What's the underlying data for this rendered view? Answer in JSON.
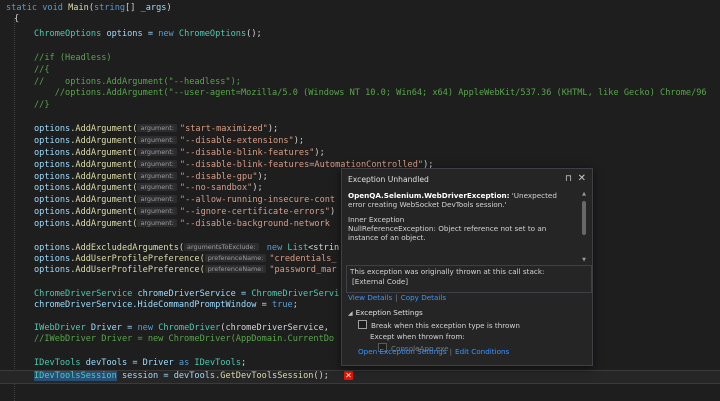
{
  "code": {
    "l1": {
      "kw": "static void",
      "fn": "Main",
      "p1": "(",
      "ty": "string",
      "p2": "[] ",
      "arg": "_args",
      "p3": ")"
    },
    "l2": "{",
    "l3": {
      "ty1": "ChromeOptions",
      "var": " options = ",
      "kw": "new",
      "ty2": " ChromeOptions",
      "rest": "();"
    },
    "l4": "//if (Headless)",
    "l5": "//{",
    "l6": "//    options.AddArgument(\"--headless\");",
    "l7": "    //options.AddArgument(\"--user-agent=Mozilla/5.0 (Windows NT 10.0; Win64; x64) AppleWebKit/537.36 (KHTML, like Gecko) Chrome/96",
    "l8": "//}",
    "args": [
      "\"start-maximized\"",
      "\"--disable-extensions\"",
      "\"--disable-blink-features\"",
      "\"--disable-blink-features=AutomationControlled\"",
      "\"--disable-gpu\"",
      "\"--no-sandbox\"",
      "\"--allow-running-insecure-cont",
      "\"--ignore-certificate-errors\"",
      "\"--disable-background-network"
    ],
    "args_tail": [
      ");",
      ");",
      ");",
      ");",
      ");",
      ");",
      "",
      ")",
      ""
    ],
    "args_obj": "options",
    "args_fn": ".AddArgument(",
    "hint_argument": "argument:",
    "hint_args_excl": "argumentsToExclude:",
    "hint_pref": "preferenceName:",
    "excl": {
      "fn": ".AddExcludedArguments(",
      "kw": " new",
      "ty": " List",
      "rest": "<strin"
    },
    "pref1": {
      "fn": ".AddUserProfilePreference(",
      "str": "\"credentials_"
    },
    "pref2": {
      "fn": ".AddUserProfilePreference(",
      "str": "\"password_mar"
    },
    "svc1": {
      "ty": "ChromeDriverService",
      "var": " chromeDriverService = ",
      "ty2": "ChromeDriverServi"
    },
    "svc2": {
      "text": "chromeDriverService.",
      "prop": "HideCommandPromptWindow",
      "rest": " = ",
      "kw": "true",
      "end": ";"
    },
    "drv1": {
      "ty": "IWebDriver",
      "var": " Driver = ",
      "kw": "new",
      "ty2": " ChromeDriver",
      "rest": "(chromeDriverService,"
    },
    "drv2": "//IWebDriver Driver = new ChromeDriver(AppDomain.CurrentDo",
    "dev1": {
      "ty": "IDevTools",
      "var": " devTools = Driver ",
      "kw": "as",
      "ty2": " IDevTools",
      "end": ";"
    },
    "dev2": {
      "ty": "IDevToolsSession",
      "var": " session = devTools.",
      "fn": "GetDevToolsSession",
      "end": "();"
    }
  },
  "popup": {
    "title": "Exception Unhandled",
    "exception_type": "OpenQA.Selenium.WebDriverException:",
    "exception_msg": " 'Unexpected error creating WebSocket DevTools session.'",
    "inner_label": "Inner Exception",
    "inner_msg": "NullReferenceException: Object reference not set to an instance of an object.",
    "stack_note": "This exception was originally thrown at this call stack:",
    "stack_frame": "[External Code]",
    "view_details": "View Details",
    "copy_details": "Copy Details",
    "settings_title": "Exception Settings",
    "break_label": "Break when this exception type is thrown",
    "except_label": "Except when thrown from:",
    "module": "ConsoleApp.exe",
    "open_settings": "Open Exception Settings",
    "edit_conditions": "Edit Conditions"
  },
  "colors": {
    "error": "#e51400",
    "link": "#3794ff",
    "selection": "#264f78"
  }
}
